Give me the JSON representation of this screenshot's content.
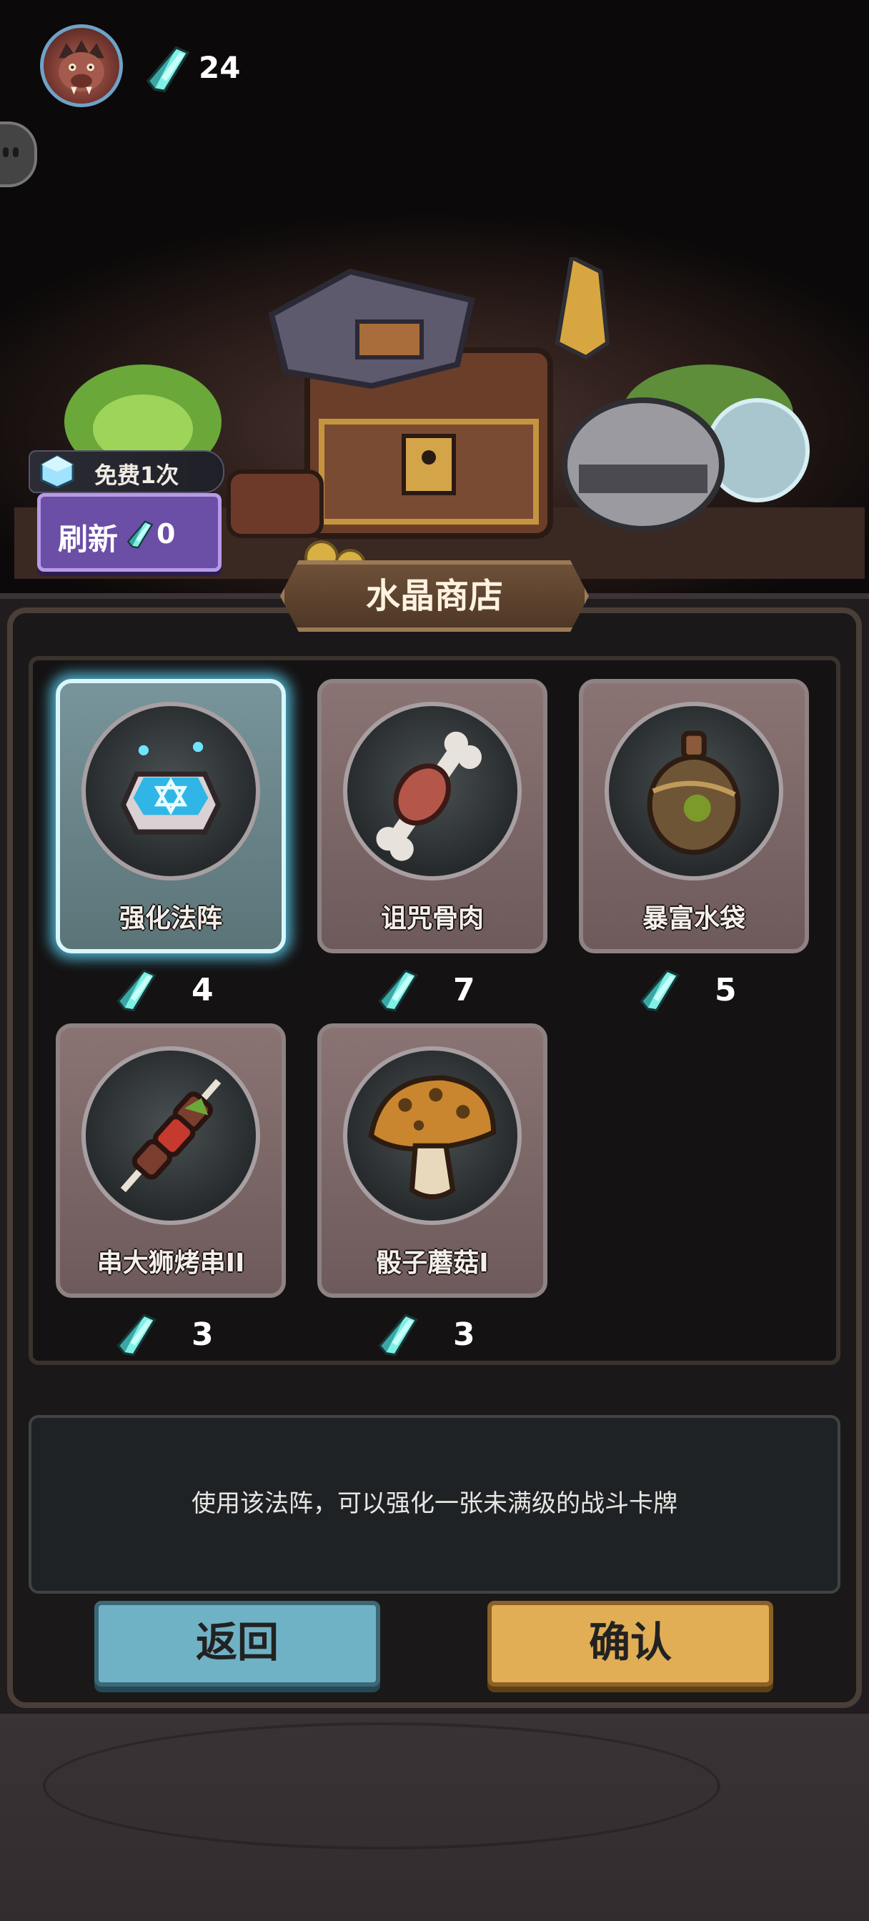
{
  "header": {
    "currency_value": "24",
    "avatar_icon": "boar-avatar-icon",
    "currency_icon": "crystal-icon"
  },
  "refresh": {
    "free_label": "免费1次",
    "button_label": "刷新",
    "cost": "0"
  },
  "shop": {
    "title": "水晶商店",
    "items": [
      {
        "name": "强化法阵",
        "price": "4",
        "icon": "magic-circle-icon",
        "selected": true
      },
      {
        "name": "诅咒骨肉",
        "price": "7",
        "icon": "cursed-bone-meat-icon",
        "selected": false
      },
      {
        "name": "暴富水袋",
        "price": "5",
        "icon": "water-bag-icon",
        "selected": false
      },
      {
        "name": "串大狮烤串II",
        "price": "3",
        "icon": "skewer-icon",
        "selected": false
      },
      {
        "name": "骰子蘑菇I",
        "price": "3",
        "icon": "dice-mushroom-icon",
        "selected": false
      }
    ],
    "description": "使用该法阵，可以强化一张未满级的战斗卡牌"
  },
  "buttons": {
    "back_label": "返回",
    "confirm_label": "确认"
  },
  "colors": {
    "selected_glow": "#5fdcff",
    "back_button": "#6fb2c5",
    "confirm_button": "#e1ae55",
    "refresh_button": "#6b4ea5",
    "crystal": "#5fd6cf"
  }
}
